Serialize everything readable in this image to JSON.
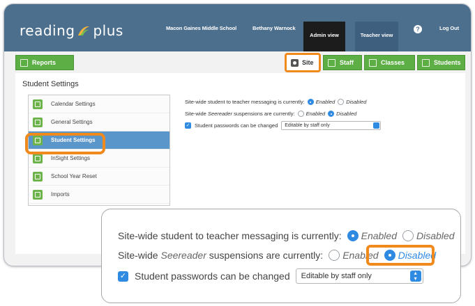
{
  "header": {
    "logo_left": "reading",
    "logo_right": "plus",
    "school": "Macon Gaines Middle School",
    "user": "Bethany Warnock",
    "admin_tab": "Admin view",
    "teacher_tab": "Teacher view",
    "help": "?",
    "logout": "Log Out"
  },
  "toolbar": {
    "reports": "Reports",
    "site": "Site",
    "staff": "Staff",
    "classes": "Classes",
    "students": "Students"
  },
  "panel": {
    "title": "Student Settings",
    "menu": [
      {
        "label": "Calendar Settings",
        "icon": "calendar-icon"
      },
      {
        "label": "General Settings",
        "icon": "figure-icon"
      },
      {
        "label": "Student Settings",
        "icon": "student-icon",
        "active": true
      },
      {
        "label": "InSight Settings",
        "icon": "insight-icon"
      },
      {
        "label": "School Year Reset",
        "icon": "reset-icon"
      },
      {
        "label": "Imports",
        "icon": "import-icon"
      }
    ],
    "messaging_label": "Site-wide student to teacher messaging is currently:",
    "suspension_prefix": "Site-wide",
    "suspension_italic": "Seereader",
    "suspension_suffix": "suspensions are currently:",
    "enabled": "Enabled",
    "disabled": "Disabled",
    "password_label": "Student passwords can be changed",
    "password_select": "Editable by staff only"
  },
  "colors": {
    "header": "#4d6f8e",
    "green": "#5cae45",
    "highlight": "#f08a1d",
    "active": "#5b96cb",
    "radio_on": "#2f8ae2"
  }
}
